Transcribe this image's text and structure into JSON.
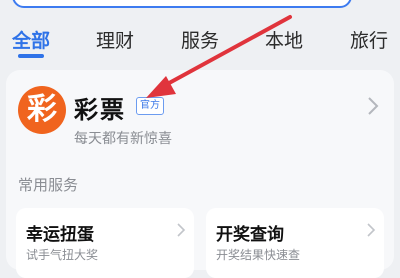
{
  "tabs": [
    {
      "label": "全部",
      "active": true
    },
    {
      "label": "理财",
      "active": false
    },
    {
      "label": "服务",
      "active": false
    },
    {
      "label": "本地",
      "active": false
    },
    {
      "label": "旅行",
      "active": false
    }
  ],
  "app": {
    "logo_char": "彩",
    "name": "彩票",
    "badge": "官方",
    "description": "每天都有新惊喜"
  },
  "section": {
    "title": "常用服务"
  },
  "services": [
    {
      "title": "幸运扭蛋",
      "subtitle": "试手气扭大奖"
    },
    {
      "title": "开奖查询",
      "subtitle": "开奖结果快速查"
    }
  ],
  "colors": {
    "accent": "#2f73e8",
    "logo": "#f0641e",
    "arrow": "#e0343c"
  },
  "icons": {
    "chevron": "chevron-right-icon",
    "annotation": "red-arrow"
  }
}
